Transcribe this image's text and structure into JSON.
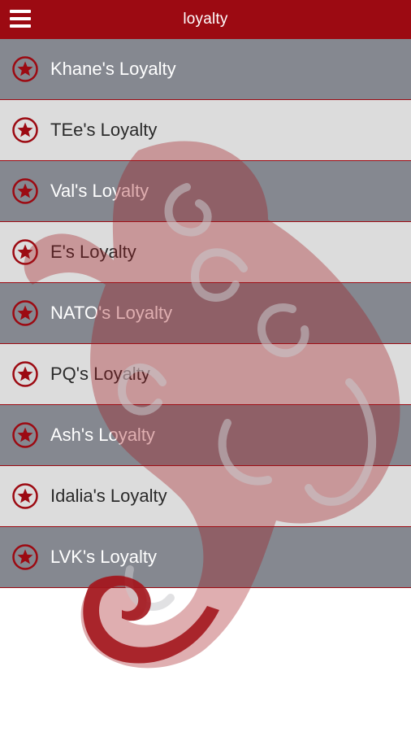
{
  "header": {
    "title": "loyalty",
    "menu_icon": "hamburger-menu-icon"
  },
  "colors": {
    "brand": "#9c0a12",
    "row_dark": "#858890",
    "row_light": "#dcdcdc",
    "watermark": "#a3161d"
  },
  "list": {
    "item_icon": "star-circle-icon",
    "items": [
      {
        "label": "Khane's Loyalty"
      },
      {
        "label": "TEe's Loyalty"
      },
      {
        "label": "Val's Loyalty"
      },
      {
        "label": "E's Loyalty"
      },
      {
        "label": "NATO's Loyalty"
      },
      {
        "label": "PQ's Loyalty"
      },
      {
        "label": "Ash's Loyalty"
      },
      {
        "label": "Idalia's Loyalty"
      },
      {
        "label": "LVK's Loyalty"
      }
    ]
  },
  "watermark_icon": "tribal-lion-logo"
}
